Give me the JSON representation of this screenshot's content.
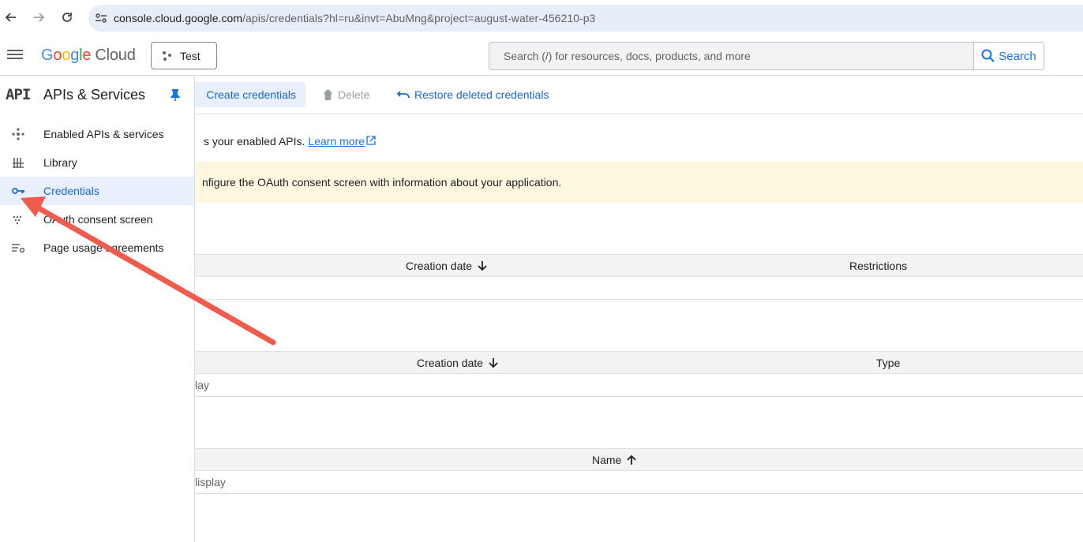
{
  "browser": {
    "url_host": "console.cloud.google.com",
    "url_path": "/apis/credentials?hl=ru&invt=AbuMng&project=august-water-456210-p3"
  },
  "header": {
    "logo_google": [
      "G",
      "o",
      "o",
      "g",
      "l",
      "e"
    ],
    "logo_cloud": "Cloud",
    "project_name": "Test",
    "search_placeholder": "Search (/) for resources, docs, products, and more",
    "search_label": "Search"
  },
  "sidebar": {
    "badge": "API",
    "title": "APIs & Services",
    "items": [
      {
        "label": "Enabled APIs & services",
        "icon": "hub-icon"
      },
      {
        "label": "Library",
        "icon": "library-icon"
      },
      {
        "label": "Credentials",
        "icon": "key-icon",
        "active": true
      },
      {
        "label": "OAuth consent screen",
        "icon": "consent-icon"
      },
      {
        "label": "Page usage agreements",
        "icon": "settings-list-icon"
      }
    ]
  },
  "toolbar": {
    "create_label": "Create credentials",
    "delete_label": "Delete",
    "restore_label": "Restore deleted credentials"
  },
  "main": {
    "intro_text": "s your enabled APIs.",
    "learn_more": "Learn more",
    "banner_text": "nfigure the OAuth consent screen with information about your application.",
    "tables": [
      {
        "headers": [
          "Creation date",
          "Restrictions"
        ],
        "sort": "down",
        "row": ""
      },
      {
        "headers": [
          "Creation date",
          "Type"
        ],
        "sort": "down",
        "row": "lay"
      },
      {
        "headers": [
          "Name"
        ],
        "sort": "up",
        "row": "lisplay"
      }
    ]
  },
  "colors": {
    "accent": "#1967d2",
    "active_bg": "#e8f0fe",
    "banner_bg": "#fef7e0",
    "annotation_arrow": "#ef5b4c"
  }
}
